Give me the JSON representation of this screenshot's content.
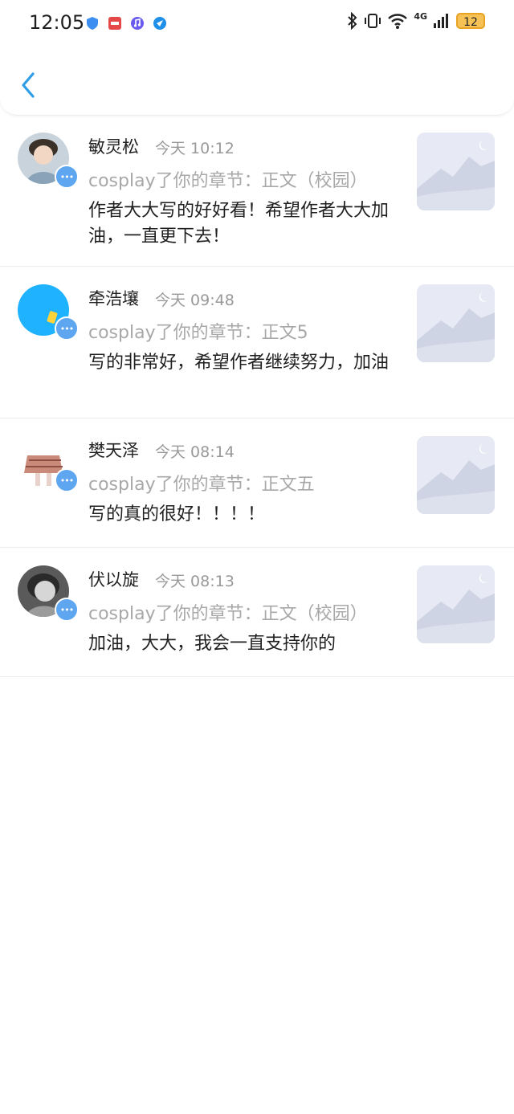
{
  "status_bar": {
    "time": "12:05",
    "network": "4G",
    "battery": "12"
  },
  "header": {
    "back_icon": "chevron-left-icon"
  },
  "colors": {
    "accent": "#2e9ee6",
    "badge": "#5ea6f0",
    "muted": "#a8a8a8"
  },
  "notifications": [
    {
      "name": "敏灵松",
      "time": "今天 10:12",
      "action": "cosplay了你的章节：正文（校园）",
      "comment": "作者大大写的好好看！希望作者大大加油，一直更下去！"
    },
    {
      "name": "牵浩壤",
      "time": "今天 09:48",
      "action": "cosplay了你的章节：正文5",
      "comment": "写的非常好，希望作者继续努力，加油"
    },
    {
      "name": "樊天泽",
      "time": "今天 08:14",
      "action": "cosplay了你的章节：正文五",
      "comment": "写的真的很好！！！！"
    },
    {
      "name": "伏以旋",
      "time": "今天 08:13",
      "action": "cosplay了你的章节：正文（校园）",
      "comment": "加油，大大，我会一直支持你的"
    }
  ]
}
